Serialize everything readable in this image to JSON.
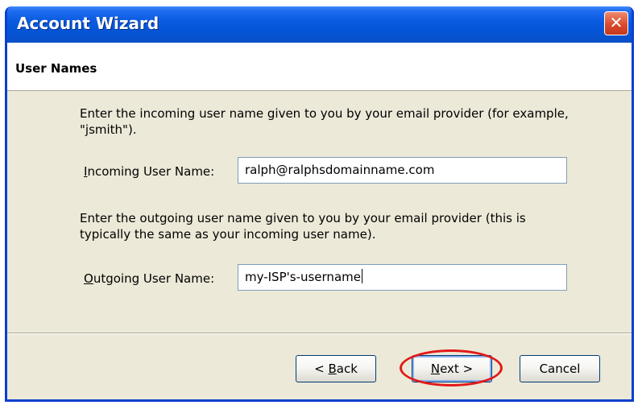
{
  "window": {
    "title": "Account Wizard",
    "close_symbol": "✕"
  },
  "header": {
    "heading": "User Names"
  },
  "incoming": {
    "instruction": "Enter the incoming user name given to you by your email provider (for example, \"jsmith\").",
    "label_accel": "I",
    "label_rest": "ncoming User Name:",
    "value": "ralph@ralphsdomainname.com"
  },
  "outgoing": {
    "instruction": "Enter the outgoing user name given to you by your email provider (this is typically the same as your incoming user name).",
    "label_accel": "O",
    "label_rest": "utgoing User Name:",
    "value": "my-ISP's-username"
  },
  "buttons": {
    "back_prefix": "< ",
    "back_accel": "B",
    "back_rest": "ack",
    "next_accel": "N",
    "next_rest": "ext >",
    "cancel": "Cancel"
  },
  "colors": {
    "titlebar": "#0554d6",
    "highlight": "#e21919"
  }
}
